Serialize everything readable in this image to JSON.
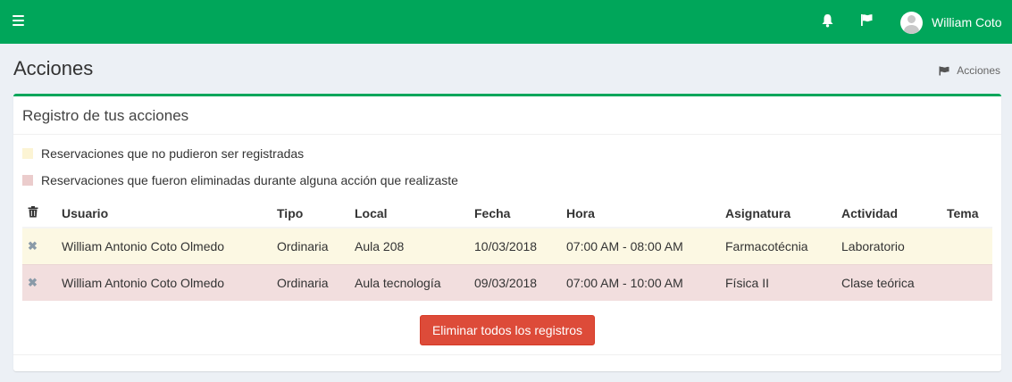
{
  "header": {
    "user_name": "William Coto",
    "brand_color": "#00a65a",
    "icons": [
      "menu-icon",
      "bell-icon",
      "flag-icon",
      "user-avatar"
    ]
  },
  "page": {
    "title": "Acciones",
    "breadcrumb": "Acciones"
  },
  "box": {
    "title": "Registro de tus acciones",
    "legend": [
      {
        "label": "Reservaciones que no pudieron ser registradas",
        "color": "#fcf4d4"
      },
      {
        "label": "Reservaciones que fueron eliminadas durante alguna acción que realizaste",
        "color": "#ebcccc"
      }
    ],
    "table": {
      "headers": [
        "Usuario",
        "Tipo",
        "Local",
        "Fecha",
        "Hora",
        "Asignatura",
        "Actividad",
        "Tema"
      ],
      "rows": [
        {
          "usuario": "William Antonio Coto Olmedo",
          "tipo": "Ordinaria",
          "local": "Aula 208",
          "fecha": "10/03/2018",
          "hora": "07:00 AM - 08:00 AM",
          "asignatura": "Farmacotécnia",
          "actividad": "Laboratorio",
          "tema": "",
          "status": "warning"
        },
        {
          "usuario": "William Antonio Coto Olmedo",
          "tipo": "Ordinaria",
          "local": "Aula tecnología",
          "fecha": "09/03/2018",
          "hora": "07:00 AM - 10:00 AM",
          "asignatura": "Física II",
          "actividad": "Clase teórica",
          "tema": "",
          "status": "danger"
        }
      ]
    },
    "delete_all_label": "Eliminar todos los registros"
  }
}
